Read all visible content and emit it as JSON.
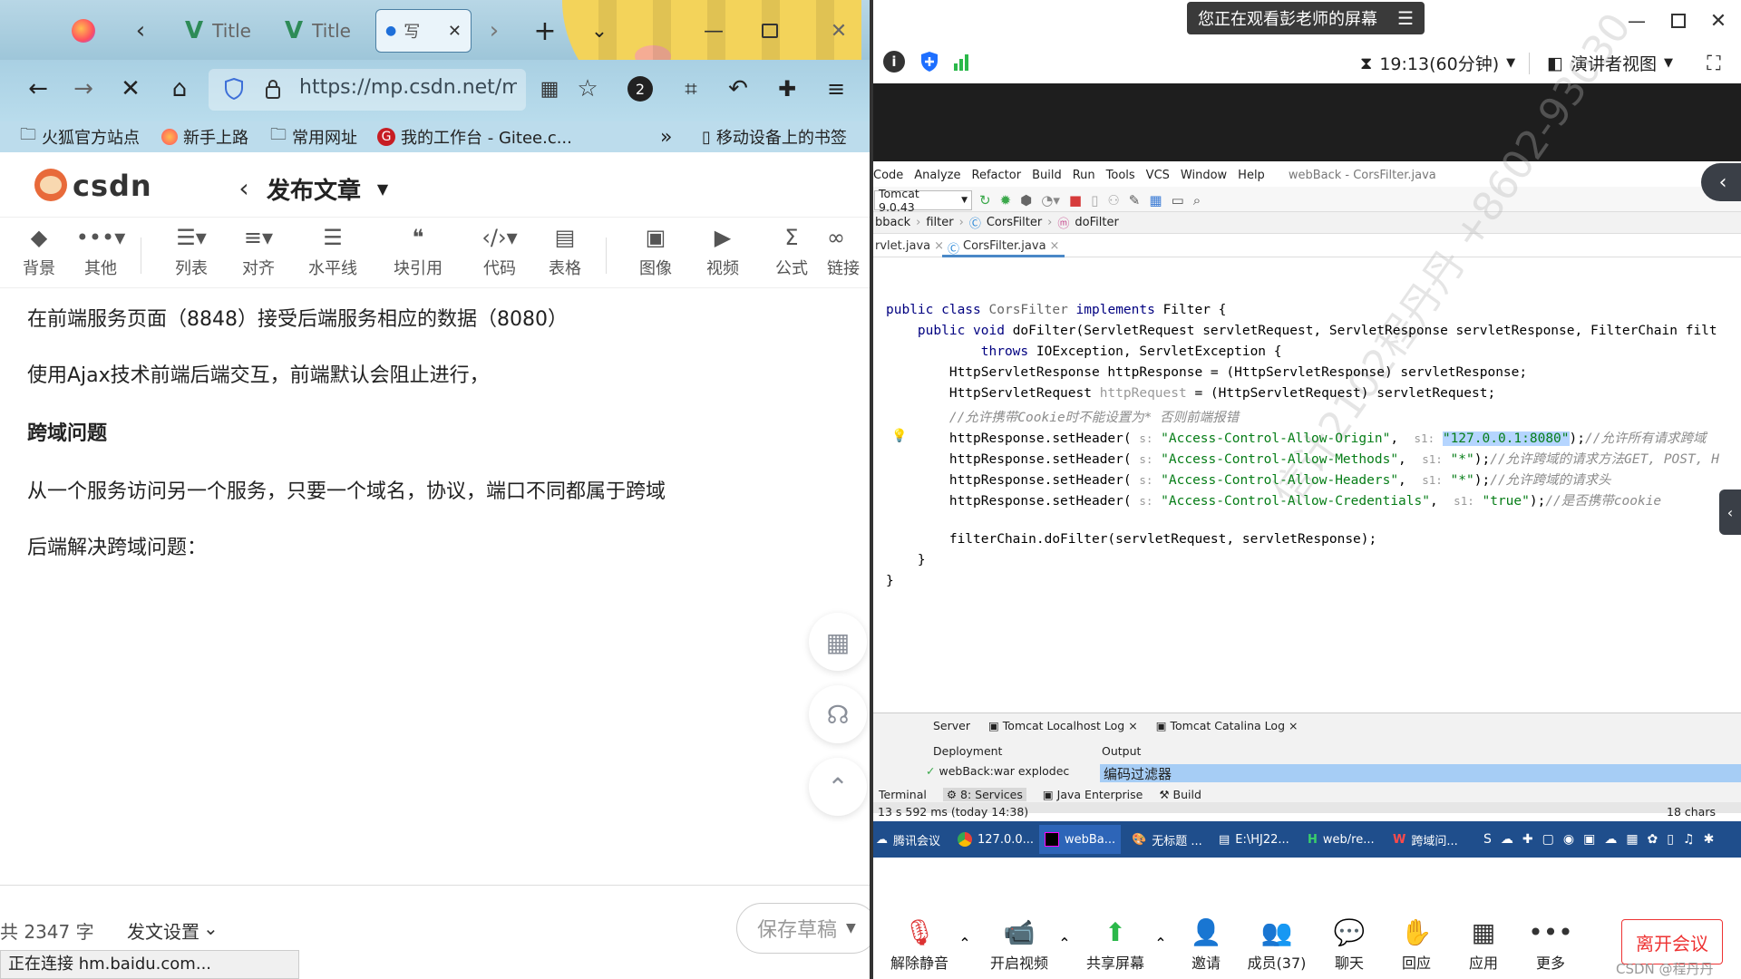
{
  "browser": {
    "tabs": [
      {
        "label": "Title"
      },
      {
        "label": "Title"
      }
    ],
    "active_tab_label": "写",
    "url": "https://mp.csdn.net/mp_",
    "badge_count": "2",
    "bookmarks": [
      {
        "label": "火狐官方站点"
      },
      {
        "label": "新手上路"
      },
      {
        "label": "常用网址"
      },
      {
        "label": "我的工作台 - Gitee.c..."
      },
      {
        "label": "移动设备上的书签"
      }
    ],
    "status_text": "正在连接 hm.baidu.com..."
  },
  "csdn": {
    "logo": "csdn",
    "page_title": "发布文章",
    "toolbar": [
      {
        "label": "背景"
      },
      {
        "label": "其他"
      },
      {
        "label": "列表"
      },
      {
        "label": "对齐"
      },
      {
        "label": "水平线"
      },
      {
        "label": "块引用"
      },
      {
        "label": "代码"
      },
      {
        "label": "表格"
      },
      {
        "label": "图像"
      },
      {
        "label": "视频"
      },
      {
        "label": "公式"
      },
      {
        "label": "链接"
      }
    ],
    "article": [
      "在前端服务页面（8848）接受后端服务相应的数据（8080）",
      "使用Ajax技术前端后端交互，前端默认会阻止进行，",
      "跨域问题",
      "从一个服务访问另一个服务，只要一个域名，协议，端口不同都属于跨域",
      "后端解决跨域问题："
    ],
    "word_count": "共 2347 字",
    "publish_settings": "发文设置",
    "save_draft": "保存草稿"
  },
  "meeting": {
    "banner": "您正在观看彭老师的屏幕",
    "timer": "19:13(60分钟)",
    "view_mode": "演讲者视图",
    "controls": [
      {
        "label": "解除静音"
      },
      {
        "label": "开启视频"
      },
      {
        "label": "共享屏幕"
      },
      {
        "label": "邀请"
      },
      {
        "label": "成员(37)"
      },
      {
        "label": "聊天"
      },
      {
        "label": "回应"
      },
      {
        "label": "应用"
      },
      {
        "label": "更多"
      }
    ],
    "leave": "离开会议",
    "footer_mark": "CSDN @程丹丹"
  },
  "ide": {
    "menu": [
      "Code",
      "Analyze",
      "Refactor",
      "Build",
      "Run",
      "Tools",
      "VCS",
      "Window",
      "Help"
    ],
    "window_title": "webBack - CorsFilter.java",
    "run_config": "Tomcat 9.0.43",
    "breadcrumbs": [
      "bback",
      "filter",
      "CorsFilter",
      "doFilter"
    ],
    "file_tabs": [
      "rvlet.java",
      "CorsFilter.java"
    ],
    "code": {
      "l1a": "public class ",
      "l1b": "CorsFilter",
      "l1c": " implements ",
      "l1d": "Filter {",
      "l2a": "    public void ",
      "l2b": "doFilter(ServletRequest servletRequest, ServletResponse servletResponse, FilterChain filt",
      "l3a": "            throws ",
      "l3b": "IOException, ServletException {",
      "l4": "        HttpServletResponse httpResponse = (HttpServletResponse) servletResponse;",
      "l5a": "        HttpServletRequest ",
      "l5b": "httpRequest",
      "l5c": " = (HttpServletRequest) servletRequest;",
      "l6": "        //允许携带Cookie时不能设置为* 否则前端报错",
      "l7a": "        httpResponse.setHeader( ",
      "l7s": "s:",
      "l7b": " \"Access-Control-Allow-Origin\"",
      "l7c": ",  ",
      "l7s1": "s1:",
      "l7d": " ",
      "l7e": "\"127.0.0.1:8080\"",
      "l7f": ");",
      "l7g": "//允许所有请求跨域",
      "l8a": "        httpResponse.setHeader( ",
      "l8s": "s:",
      "l8b": " \"Access-Control-Allow-Methods\"",
      "l8c": ",  ",
      "l8s1": "s1:",
      "l8d": " \"*\"",
      "l8f": ");",
      "l8g": "//允许跨域的请求方法GET, POST, H",
      "l9a": "        httpResponse.setHeader( ",
      "l9s": "s:",
      "l9b": " \"Access-Control-Allow-Headers\"",
      "l9c": ",  ",
      "l9s1": "s1:",
      "l9d": " \"*\"",
      "l9f": ");",
      "l9g": "//允许跨域的请求头",
      "l10a": "        httpResponse.setHeader( ",
      "l10s": "s:",
      "l10b": " \"Access-Control-Allow-Credentials\"",
      "l10c": ",  ",
      "l10s1": "s1:",
      "l10d": " \"true\"",
      "l10f": ");",
      "l10g": "//是否携带cookie",
      "l11": "        filterChain.doFilter(servletRequest, servletResponse);",
      "l12": "    }",
      "l13": "}"
    },
    "watermark": "信计2102程丹丹 +8602-93030",
    "services": {
      "tabs": [
        "Server",
        "Tomcat Localhost Log",
        "Tomcat Catalina Log"
      ],
      "deployment": "Deployment",
      "output": "Output",
      "artifact": "webBack:war explodec",
      "output_text": "编码过滤器",
      "bottom_tabs": [
        "Terminal",
        "8: Services",
        "Java Enterprise",
        "Build"
      ],
      "status_left": "13 s 592 ms (today 14:38)",
      "status_right": "18 chars"
    }
  },
  "taskbar": [
    {
      "label": "腾讯会议"
    },
    {
      "label": "127.0.0..."
    },
    {
      "label": "webBa..."
    },
    {
      "label": "无标题 ..."
    },
    {
      "label": "E:\\HJ22..."
    },
    {
      "label": "web/re..."
    },
    {
      "label": "跨域问..."
    }
  ]
}
